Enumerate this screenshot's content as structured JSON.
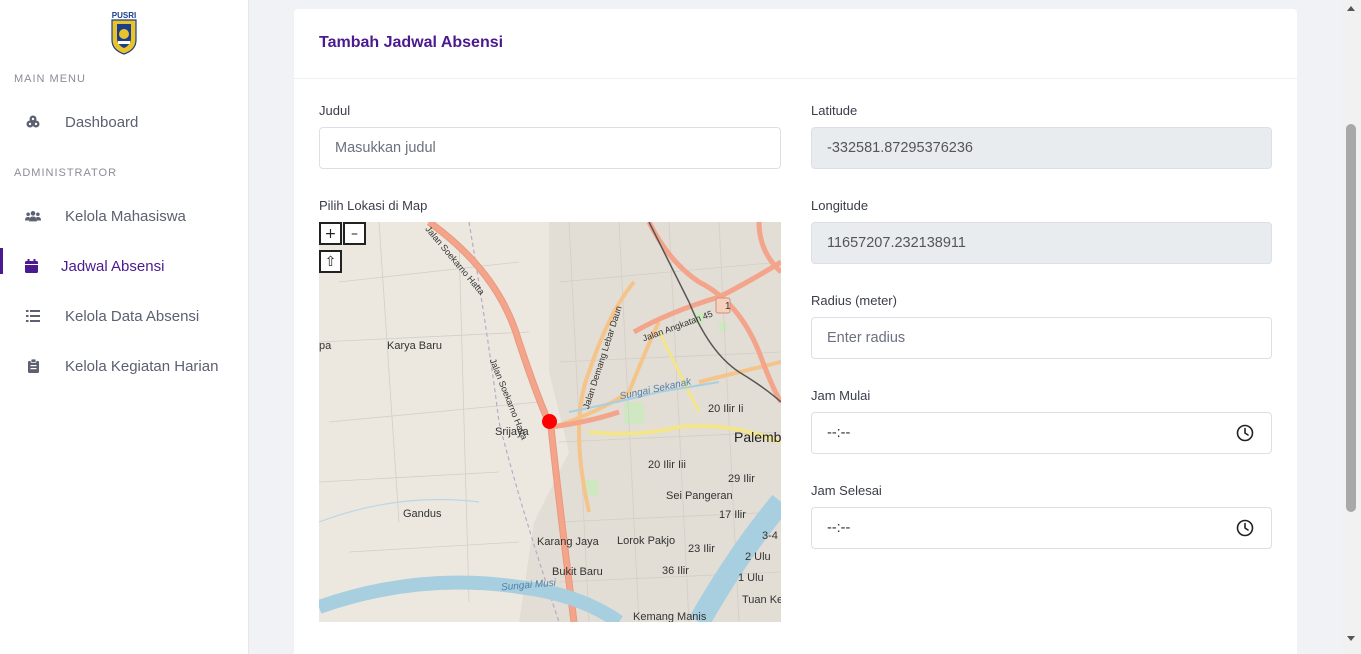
{
  "sidebar": {
    "logo_text": "PUSRI",
    "main_menu_heading": "MAIN MENU",
    "admin_heading": "ADMINISTRATOR",
    "items": [
      {
        "label": "Dashboard",
        "icon": "dashboard-icon"
      },
      {
        "label": "Kelola Mahasiswa",
        "icon": "users-icon"
      },
      {
        "label": "Jadwal Absensi",
        "icon": "calendar-icon",
        "active": true
      },
      {
        "label": "Kelola Data Absensi",
        "icon": "list-icon"
      },
      {
        "label": "Kelola Kegiatan Harian",
        "icon": "clipboard-icon"
      }
    ]
  },
  "form": {
    "title": "Tambah Jadwal Absensi",
    "judul_label": "Judul",
    "judul_placeholder": "Masukkan judul",
    "map_label": "Pilih Lokasi di Map",
    "latitude_label": "Latitude",
    "latitude_value": "-332581.87295376236",
    "longitude_label": "Longitude",
    "longitude_value": "11657207.232138911",
    "radius_label": "Radius (meter)",
    "radius_placeholder": "Enter radius",
    "jam_mulai_label": "Jam Mulai",
    "jam_mulai_value": "--:--",
    "jam_selesai_label": "Jam Selesai",
    "jam_selesai_value": "--:--"
  },
  "map": {
    "zoom_in": "+",
    "zoom_out": "–",
    "rotate": "⇧",
    "labels": {
      "karya_baru": "Karya Baru",
      "srijaya": "Srijaya",
      "gandus": "Gandus",
      "karang_jaya": "Karang Jaya",
      "lorok_pakjo": "Lorok Pakjo",
      "bukit_baru": "Bukit Baru",
      "kemang_manis": "Kemang Manis",
      "sei_pangeran": "Sei Pangeran",
      "ilir_20_ii": "20 Ilir Ii",
      "ilir_20_iii": "20 Ilir Iii",
      "ilir_29": "29 Ilir",
      "ilir_17": "17 Ilir",
      "ilir_23": "23 Ilir",
      "ilir_36": "36 Ilir",
      "ulu_2": "2 Ulu",
      "ulu_1": "1 Ulu",
      "ulu_3_4": "3-4",
      "tuan_ke": "Tuan Ke",
      "palembang": "Palemb",
      "pa": "pa",
      "sungai_sekanak": "Sungai Sekanak",
      "sungai_musi": "Sungai Musi",
      "jalan_soekarno": "Jalan Soekarno Hatta",
      "jalan_soekarno_top": "Jalan Soekarno Hatta",
      "jalan_demang": "Jalan Demang Lebar Daun",
      "jalan_angkatan": "Jalan Angkatan 45",
      "route_1": "1"
    }
  }
}
